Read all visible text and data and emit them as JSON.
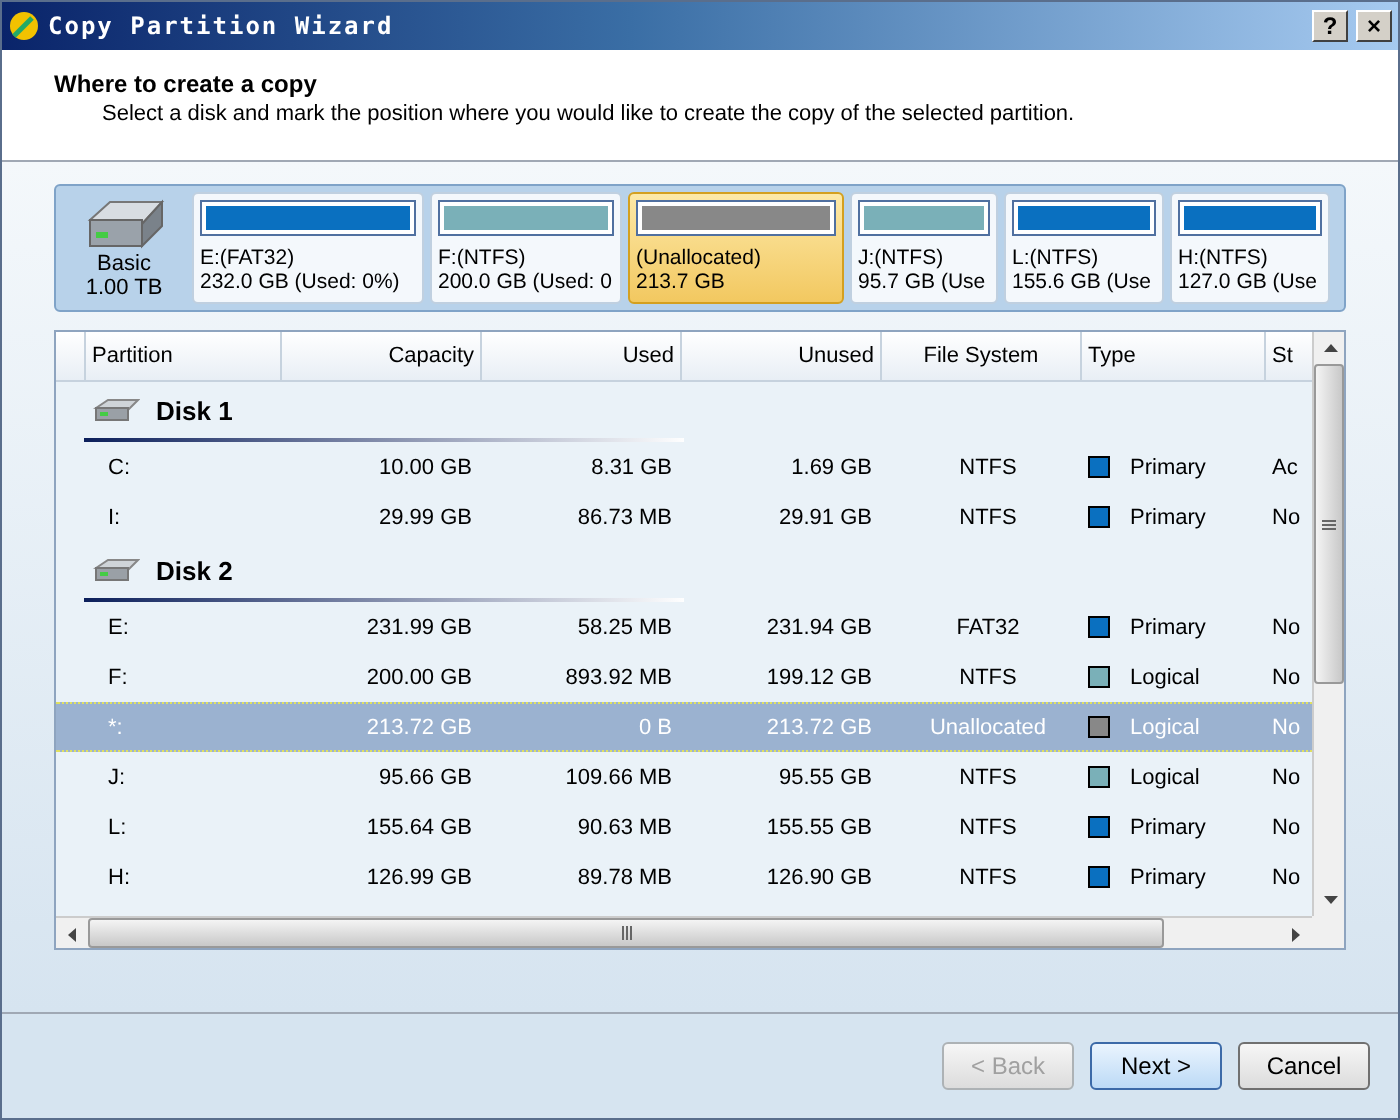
{
  "window": {
    "title": "Copy Partition Wizard",
    "buttons": [
      "?",
      "×"
    ]
  },
  "header": {
    "title": "Where to create a copy",
    "subtitle": "Select a disk and mark the position where you would like to create the copy of the selected partition."
  },
  "disk_map": {
    "disk": {
      "label": "Basic",
      "size": "1.00 TB"
    },
    "partitions": [
      {
        "name": "E:(FAT32)",
        "detail": "232.0 GB (Used: 0%)",
        "color": "#0a70c0",
        "selected": false
      },
      {
        "name": "F:(NTFS)",
        "detail": "200.0 GB (Used: 0",
        "color": "#7ab0b8",
        "selected": false
      },
      {
        "name": "(Unallocated)",
        "detail": "213.7 GB",
        "color": "#888888",
        "selected": true
      },
      {
        "name": "J:(NTFS)",
        "detail": "95.7 GB (Use",
        "color": "#7ab0b8",
        "selected": false
      },
      {
        "name": "L:(NTFS)",
        "detail": "155.6 GB (Use",
        "color": "#0a70c0",
        "selected": false
      },
      {
        "name": "H:(NTFS)",
        "detail": "127.0 GB (Use",
        "color": "#0a70c0",
        "selected": false
      }
    ]
  },
  "table": {
    "columns": [
      "Partition",
      "Capacity",
      "Used",
      "Unused",
      "File System",
      "Type",
      "St"
    ],
    "groups": [
      {
        "disk": "Disk 1",
        "rows": [
          {
            "partition": "C:",
            "capacity": "10.00 GB",
            "used": "8.31 GB",
            "unused": "1.69 GB",
            "fs": "NTFS",
            "type": "Primary",
            "color": "#0a70c0",
            "status": "Ac",
            "selected": false
          },
          {
            "partition": "I:",
            "capacity": "29.99 GB",
            "used": "86.73 MB",
            "unused": "29.91 GB",
            "fs": "NTFS",
            "type": "Primary",
            "color": "#0a70c0",
            "status": "No",
            "selected": false
          }
        ]
      },
      {
        "disk": "Disk 2",
        "rows": [
          {
            "partition": "E:",
            "capacity": "231.99 GB",
            "used": "58.25 MB",
            "unused": "231.94 GB",
            "fs": "FAT32",
            "type": "Primary",
            "color": "#0a70c0",
            "status": "No",
            "selected": false
          },
          {
            "partition": "F:",
            "capacity": "200.00 GB",
            "used": "893.92 MB",
            "unused": "199.12 GB",
            "fs": "NTFS",
            "type": "Logical",
            "color": "#7ab0b8",
            "status": "No",
            "selected": false
          },
          {
            "partition": "*:",
            "capacity": "213.72 GB",
            "used": "0 B",
            "unused": "213.72 GB",
            "fs": "Unallocated",
            "type": "Logical",
            "color": "#888888",
            "status": "No",
            "selected": true
          },
          {
            "partition": "J:",
            "capacity": "95.66 GB",
            "used": "109.66 MB",
            "unused": "95.55 GB",
            "fs": "NTFS",
            "type": "Logical",
            "color": "#7ab0b8",
            "status": "No",
            "selected": false
          },
          {
            "partition": "L:",
            "capacity": "155.64 GB",
            "used": "90.63 MB",
            "unused": "155.55 GB",
            "fs": "NTFS",
            "type": "Primary",
            "color": "#0a70c0",
            "status": "No",
            "selected": false
          },
          {
            "partition": "H:",
            "capacity": "126.99 GB",
            "used": "89.78 MB",
            "unused": "126.90 GB",
            "fs": "NTFS",
            "type": "Primary",
            "color": "#0a70c0",
            "status": "No",
            "selected": false
          }
        ]
      }
    ]
  },
  "buttons": [
    {
      "label": "< Back",
      "disabled": true,
      "kind": "default"
    },
    {
      "label": "Next >",
      "disabled": false,
      "kind": "primary"
    },
    {
      "label": "Cancel",
      "disabled": false,
      "kind": "default"
    }
  ]
}
